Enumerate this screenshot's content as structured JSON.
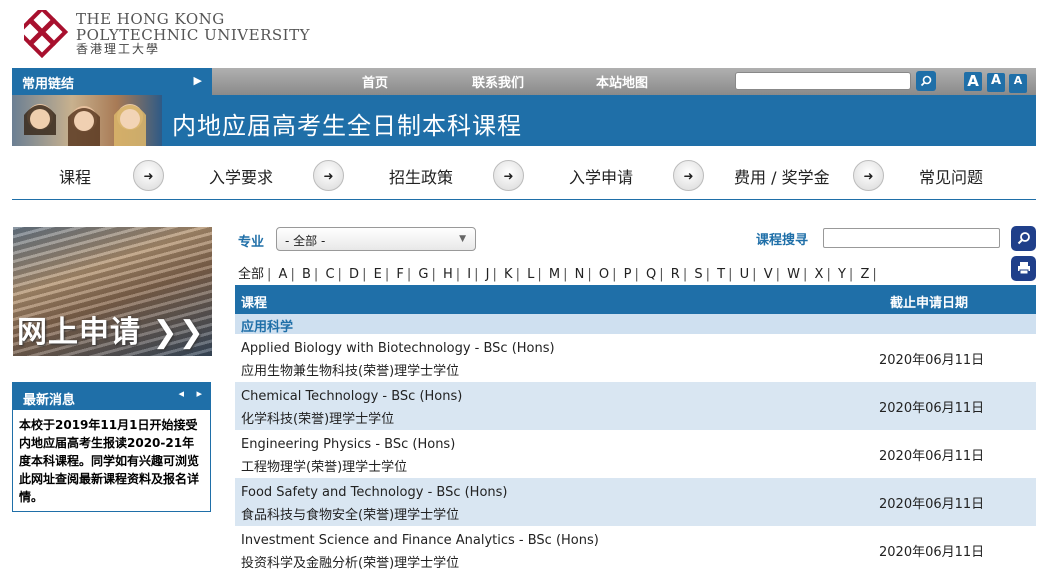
{
  "logo": {
    "en_line1": "THE HONG KONG",
    "en_line2": "POLYTECHNIC UNIVERSITY",
    "zh": "香港理工大學",
    "brand_color": "#a8102e"
  },
  "topbar": {
    "quick_links": "常用链结",
    "nav": [
      "首页",
      "联系我们",
      "本站地图"
    ],
    "search_placeholder": "",
    "font_sizes": [
      "A",
      "A",
      "A"
    ]
  },
  "banner": {
    "title": "内地应届高考生全日制本科课程"
  },
  "mainnav": {
    "items": [
      "课程",
      "入学要求",
      "招生政策",
      "入学申请",
      "费用 / 奖学金",
      "常见问题"
    ]
  },
  "sidebar": {
    "apply_text": "网上申请 ❯❯",
    "news_title": "最新消息",
    "news_body": "本校于2019年11月1日开始接受内地应届高考生报读2020-21年度本科课程。同学如有兴趣可浏览此网址查阅最新课程资料及报名详情。"
  },
  "filter": {
    "major_label": "专业",
    "major_value": "- 全部 -",
    "search_label": "课程搜寻",
    "alphabet": [
      "全部",
      "A",
      "B",
      "C",
      "D",
      "E",
      "F",
      "G",
      "H",
      "I",
      "J",
      "K",
      "L",
      "M",
      "N",
      "O",
      "P",
      "Q",
      "R",
      "S",
      "T",
      "U",
      "V",
      "W",
      "X",
      "Y",
      "Z"
    ]
  },
  "table": {
    "col_course": "课程",
    "col_deadline": "截止申请日期",
    "category": "应用科学",
    "rows": [
      {
        "en": "Applied Biology with Biotechnology - BSc (Hons)",
        "zh": "应用生物兼生物科技(荣誉)理学士学位",
        "date": "2020年06月11日"
      },
      {
        "en": "Chemical Technology - BSc (Hons)",
        "zh": "化学科技(荣誉)理学士学位",
        "date": "2020年06月11日"
      },
      {
        "en": "Engineering Physics - BSc (Hons)",
        "zh": "工程物理学(荣誉)理学士学位",
        "date": "2020年06月11日"
      },
      {
        "en": "Food Safety and Technology - BSc (Hons)",
        "zh": "食品科技与食物安全(荣誉)理学士学位",
        "date": "2020年06月11日"
      },
      {
        "en": "Investment Science and Finance Analytics - BSc (Hons)",
        "zh": "投资科学及金融分析(荣誉)理学士学位",
        "date": "2020年06月11日"
      }
    ]
  },
  "colors": {
    "primary": "#1f6fa8",
    "row_alt": "#d9e6f2",
    "category_bg": "#cfe0f0"
  }
}
